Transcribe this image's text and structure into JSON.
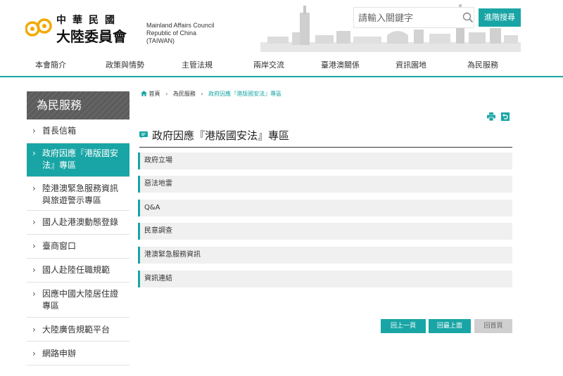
{
  "header": {
    "logo_zh_line1": "中華民國",
    "logo_zh_line2": "大陸委員會",
    "logo_en_line1": "Mainland Affairs Council",
    "logo_en_line2": "Republic of China (TAIWAN)",
    "search_placeholder": "請輸入關鍵字",
    "advanced_search_label": "進階搜尋"
  },
  "nav": {
    "items": [
      "本會簡介",
      "政策與情勢",
      "主管法規",
      "兩岸交流",
      "臺港澳關係",
      "資訊園地",
      "為民服務"
    ]
  },
  "sidebar": {
    "title": "為民服務",
    "items": [
      {
        "label": "首長信箱"
      },
      {
        "label": "政府因應『港版國安法』專區"
      },
      {
        "label": "陸港澳緊急服務資訊與旅遊警示專區"
      },
      {
        "label": "國人赴港澳動態登錄"
      },
      {
        "label": "臺商窗口"
      },
      {
        "label": "國人赴陸任職規範"
      },
      {
        "label": "因應中國大陸居住證專區"
      },
      {
        "label": "大陸廣告規範平台"
      },
      {
        "label": "網路申辦"
      }
    ]
  },
  "breadcrumb": {
    "home": "首頁",
    "section": "為民服務",
    "current": "政府因應『港版國安法』專區",
    "separator": "›"
  },
  "main": {
    "title": "政府因應『港版國安法』專區",
    "list": [
      "政府立場",
      "惡法地雷",
      "Q&A",
      "民意調查",
      "港澳緊急服務資訊",
      "資訊連結"
    ]
  },
  "buttons": {
    "back": "回上一頁",
    "top": "回最上面",
    "home": "回首頁"
  },
  "colors": {
    "accent": "#19a5a5",
    "sidebar_header": "#5c5c5c",
    "list_bg": "#f0f0f0"
  }
}
